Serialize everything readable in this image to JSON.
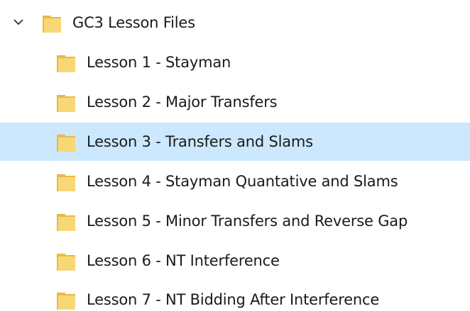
{
  "tree": {
    "root": {
      "label": "GC3 Lesson Files",
      "expanded": true,
      "icon": "folder-icon",
      "chevron_icon": "chevron-down-icon"
    },
    "children": [
      {
        "label": "Lesson 1 - Stayman",
        "selected": false,
        "icon": "folder-icon"
      },
      {
        "label": "Lesson 2 - Major Transfers",
        "selected": false,
        "icon": "folder-icon"
      },
      {
        "label": "Lesson 3 - Transfers and Slams",
        "selected": true,
        "icon": "folder-icon"
      },
      {
        "label": "Lesson 4 - Stayman Quantative and Slams",
        "selected": false,
        "icon": "folder-icon"
      },
      {
        "label": "Lesson 5 - Minor Transfers and Reverse Gap",
        "selected": false,
        "icon": "folder-icon"
      },
      {
        "label": "Lesson 6 - NT Interference",
        "selected": false,
        "icon": "folder-icon"
      },
      {
        "label": "Lesson 7 - NT Bidding After Interference",
        "selected": false,
        "icon": "folder-icon"
      }
    ]
  },
  "colors": {
    "selection": "#cce8ff",
    "folder_body": "#f8d775",
    "folder_back": "#e8b949",
    "chevron": "#333333",
    "text": "#1a1a1a"
  }
}
